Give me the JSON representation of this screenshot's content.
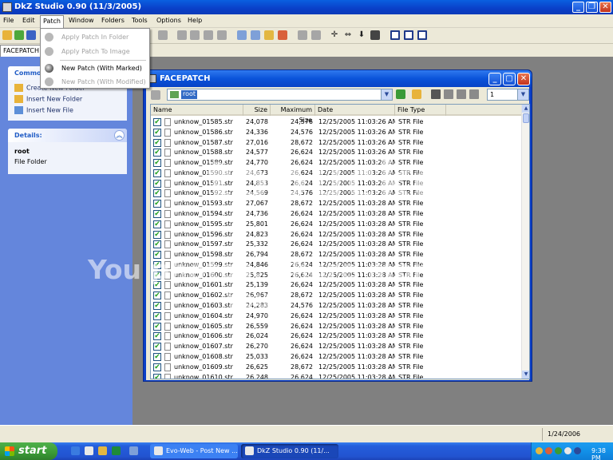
{
  "window": {
    "title": "DkZ Studio 0.90 (11/3/2005)"
  },
  "menu": [
    "File",
    "Edit",
    "Patch",
    "Window",
    "Folders",
    "Tools",
    "Options",
    "Help"
  ],
  "patch_menu": {
    "items": [
      {
        "label": "Apply Patch In Folder",
        "enabled": false
      },
      {
        "label": "Apply Patch To Image",
        "enabled": false
      },
      {
        "label": "New Patch (With Marked)",
        "enabled": true
      },
      {
        "label": "New Patch (With Modified)",
        "enabled": false
      }
    ]
  },
  "doc_tab": {
    "label": "FACEPATCH"
  },
  "task_pane": {
    "commands": {
      "title": "Commo",
      "items": [
        "Create New Folder",
        "Insert New Folder",
        "Insert New File"
      ]
    },
    "details": {
      "title": "Details:",
      "name": "root",
      "type": "File Folder"
    }
  },
  "child_window": {
    "title": "FACEPATCH",
    "address": "root",
    "count": "1",
    "columns": [
      "Name",
      "Size",
      "Maximum Size",
      "Date",
      "File Type"
    ],
    "rows": [
      [
        "unknow_01585.str",
        "24,078",
        "24,576",
        "12/25/2005 11:03:26 AM",
        "STR File"
      ],
      [
        "unknow_01586.str",
        "24,336",
        "24,576",
        "12/25/2005 11:03:26 AM",
        "STR File"
      ],
      [
        "unknow_01587.str",
        "27,016",
        "28,672",
        "12/25/2005 11:03:26 AM",
        "STR File"
      ],
      [
        "unknow_01588.str",
        "24,577",
        "26,624",
        "12/25/2005 11:03:26 AM",
        "STR File"
      ],
      [
        "unknow_01589.str",
        "24,770",
        "26,624",
        "12/25/2005 11:03:26 AM",
        "STR File"
      ],
      [
        "unknow_01590.str",
        "24,673",
        "26,624",
        "12/25/2005 11:03:26 AM",
        "STR File"
      ],
      [
        "unknow_01591.str",
        "24,853",
        "26,624",
        "12/25/2005 11:03:26 AM",
        "STR File"
      ],
      [
        "unknow_01592.str",
        "24,569",
        "24,576",
        "12/25/2005 11:03:26 AM",
        "STR File"
      ],
      [
        "unknow_01593.str",
        "27,067",
        "28,672",
        "12/25/2005 11:03:28 AM",
        "STR File"
      ],
      [
        "unknow_01594.str",
        "24,736",
        "26,624",
        "12/25/2005 11:03:28 AM",
        "STR File"
      ],
      [
        "unknow_01595.str",
        "25,801",
        "26,624",
        "12/25/2005 11:03:28 AM",
        "STR File"
      ],
      [
        "unknow_01596.str",
        "24,823",
        "26,624",
        "12/25/2005 11:03:28 AM",
        "STR File"
      ],
      [
        "unknow_01597.str",
        "25,332",
        "26,624",
        "12/25/2005 11:03:28 AM",
        "STR File"
      ],
      [
        "unknow_01598.str",
        "26,794",
        "28,672",
        "12/25/2005 11:03:28 AM",
        "STR File"
      ],
      [
        "unknow_01599.str",
        "24,846",
        "26,624",
        "12/25/2005 11:03:28 AM",
        "STR File"
      ],
      [
        "unknow_01600.str",
        "25,825",
        "26,624",
        "12/25/2005 11:03:28 AM",
        "STR File"
      ],
      [
        "unknow_01601.str",
        "25,139",
        "26,624",
        "12/25/2005 11:03:28 AM",
        "STR File"
      ],
      [
        "unknow_01602.str",
        "26,967",
        "28,672",
        "12/25/2005 11:03:28 AM",
        "STR File"
      ],
      [
        "unknow_01603.str",
        "24,283",
        "24,576",
        "12/25/2005 11:03:28 AM",
        "STR File"
      ],
      [
        "unknow_01604.str",
        "24,970",
        "26,624",
        "12/25/2005 11:03:28 AM",
        "STR File"
      ],
      [
        "unknow_01605.str",
        "26,559",
        "26,624",
        "12/25/2005 11:03:28 AM",
        "STR File"
      ],
      [
        "unknow_01606.str",
        "26,024",
        "26,624",
        "12/25/2005 11:03:28 AM",
        "STR File"
      ],
      [
        "unknow_01607.str",
        "26,270",
        "26,624",
        "12/25/2005 11:03:28 AM",
        "STR File"
      ],
      [
        "unknow_01608.str",
        "25,033",
        "26,624",
        "12/25/2005 11:03:28 AM",
        "STR File"
      ],
      [
        "unknow_01609.str",
        "26,625",
        "28,672",
        "12/25/2005 11:03:28 AM",
        "STR File"
      ],
      [
        "unknow_01610.str",
        "26,248",
        "26,624",
        "12/25/2005 11:03:28 AM",
        "STR File"
      ]
    ]
  },
  "watermark": {
    "big": "tobucke",
    "line1": "You  photos.  Share  moments.",
    "line2": "Your"
  },
  "status": {
    "date": "1/24/2006"
  },
  "taskbar": {
    "start": "start",
    "tasks": [
      "Evo-Web - Post New ...",
      "DkZ Studio 0.90 (11/..."
    ],
    "clock": "9:38 PM"
  },
  "colors": {
    "titlebar": "#0a3fc8",
    "taskpane": "#6486dc",
    "selection": "#316ac5",
    "start": "#3a9a36"
  }
}
